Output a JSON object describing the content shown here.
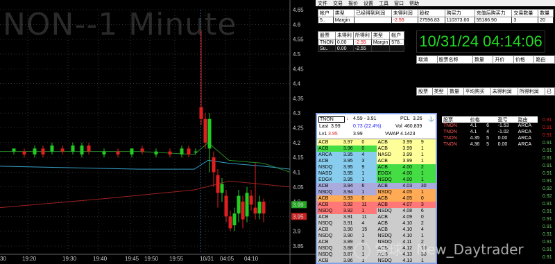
{
  "chart": {
    "watermark": "NON--1 Minute",
    "price_labels": [
      "4.65",
      "4.6",
      "4.55",
      "4.5",
      "4.45",
      "4.4",
      "4.35",
      "4.3",
      "4.25",
      "4.2",
      "4.15",
      "4.1",
      "4.05",
      "4.0",
      "3.95",
      "3.9",
      "3.85"
    ],
    "time_labels": [
      "19:20",
      "19:30",
      "19:40",
      "19:45",
      "19:50",
      "19:55",
      "10/31",
      "04:05",
      "04:10"
    ],
    "left_time": "30",
    "current_price_tag": "3.99",
    "low_price_tag": "3.95",
    "colors": {
      "up": "#22cc22",
      "down": "#e02020",
      "ema_green": "#2a8a2a",
      "ema_blue": "#36a0c8",
      "ema_red": "#a02020",
      "grid": "#555"
    }
  },
  "menu": [
    "文件",
    "交易",
    "报价",
    "设置",
    "工具",
    "窗口",
    "帮助"
  ],
  "account_table": {
    "headers": [
      "帐户",
      "类型",
      "已经得到利润",
      "未得利润",
      "股权",
      "购买力",
      "充值后购买力",
      "交易数量",
      "数量"
    ],
    "row": [
      "5..",
      "Margin",
      "",
      "-2.55",
      "27596.83",
      "110373.60",
      "55186.90",
      "3",
      "20"
    ]
  },
  "position_table": {
    "headers": [
      "股票",
      "未得利",
      "所得利",
      "类型",
      "帐户"
    ],
    "rows": [
      [
        "TNON",
        "0.00",
        "-2.55",
        "Margin",
        "578.."
      ],
      [
        "Su..",
        "0.00",
        "-2.55",
        "",
        ""
      ]
    ]
  },
  "clock": "10/31/24 04:14:06",
  "orders_headers": [
    "取消",
    "股票名称",
    "数量",
    "开价",
    "价格",
    "路由"
  ],
  "summary_headers": [
    "股票",
    "类型",
    "数量",
    "平均购买",
    "未得利润",
    "所得利润",
    "已"
  ],
  "level2": {
    "symbol": "TNON",
    "range": "4.59 - 3.91",
    "pcl_label": "PCL",
    "pcl_value": "3.26",
    "last_label": "Last",
    "last_value": "3.99",
    "change": "0.73",
    "change_pct": "(22.4%)",
    "vol_label": "Vol",
    "vol_value": "460,839",
    "lv1_label": "Lv1",
    "lv1_bid": "3.95",
    "lv1_ask": "3.99",
    "vwap_label": "VWAP",
    "vwap_value": "4.1423",
    "bids": [
      [
        "ACB",
        "3.97",
        "0"
      ],
      [
        "ACB",
        "3.96",
        "0"
      ],
      [
        "ARCA",
        "3.95",
        "4"
      ],
      [
        "ACB",
        "3.95",
        "3"
      ],
      [
        "NSDQ",
        "3.95",
        "9"
      ],
      [
        "NASD",
        "3.95",
        "1"
      ],
      [
        "EDGX",
        "3.95",
        "1"
      ],
      [
        "ACB",
        "3.94",
        "6"
      ],
      [
        "NSDQ",
        "3.94",
        "1"
      ],
      [
        "ACB",
        "3.93",
        "0"
      ],
      [
        "ACB",
        "3.92",
        "11"
      ],
      [
        "NSDQ",
        "3.92",
        "1"
      ],
      [
        "ACB",
        "3.91",
        "11"
      ],
      [
        "NSDQ",
        "3.91",
        "4"
      ],
      [
        "ACB",
        "3.90",
        "15"
      ],
      [
        "NSDQ",
        "3.90",
        "1"
      ],
      [
        "ACB",
        "3.89",
        "0"
      ],
      [
        "NSDQ",
        "3.88",
        "1"
      ],
      [
        "NSDQ",
        "3.87",
        "1"
      ],
      [
        "ACB",
        "3.86",
        "1"
      ],
      [
        "NSDQ",
        "3.85",
        "1"
      ]
    ],
    "bid_colors": [
      "#ffff99",
      "#44dd44",
      "#88ccee",
      "#88ccee",
      "#88ccee",
      "#88ccee",
      "#88ccee",
      "#aaaadd",
      "#aaaadd",
      "#ffaa55",
      "#ff7777",
      "#ff7777",
      "#cccccc",
      "#cccccc",
      "#cccccc",
      "#cccccc",
      "#cccccc",
      "#cccccc",
      "#cccccc",
      "#cccccc",
      "#cccccc"
    ],
    "asks": [
      [
        "ACB",
        "3.99",
        "9"
      ],
      [
        "ACB",
        "3.99",
        "1"
      ],
      [
        "NASD",
        "3.99",
        "1"
      ],
      [
        "ACB",
        "3.99",
        "1"
      ],
      [
        "ACB",
        "4.00",
        "2"
      ],
      [
        "EDGX",
        "4.00",
        "1"
      ],
      [
        "NSDQ",
        "4.00",
        "1"
      ],
      [
        "ACB",
        "4.03",
        "30"
      ],
      [
        "NSDQ",
        "4.05",
        "1"
      ],
      [
        "ACB",
        "4.05",
        "0"
      ],
      [
        "ACB",
        "4.07",
        "3"
      ],
      [
        "NSDQ",
        "4.08",
        "6"
      ],
      [
        "ACB",
        "4.09",
        "0"
      ],
      [
        "ACB",
        "4.10",
        "2"
      ],
      [
        "ACB",
        "4.10",
        "4"
      ],
      [
        "NSDQ",
        "4.10",
        "1"
      ],
      [
        "NSDQ",
        "4.11",
        "2"
      ],
      [
        "ACB",
        "4.12",
        "10"
      ],
      [
        "ACB",
        "4.13",
        "30"
      ],
      [
        "NSDQ",
        "4.13",
        "1"
      ],
      [
        "ACB",
        "4.15",
        "2"
      ]
    ],
    "ask_colors": [
      "#ffff99",
      "#ffff99",
      "#ffff99",
      "#ffff99",
      "#44dd44",
      "#44dd44",
      "#44dd44",
      "#aaaadd",
      "#ffaa55",
      "#ffaa55",
      "#ff7777",
      "#cccccc",
      "#cccccc",
      "#cccccc",
      "#cccccc",
      "#cccccc",
      "#cccccc",
      "#cccccc",
      "#cccccc",
      "#cccccc",
      "#cccccc"
    ]
  },
  "trades": {
    "headers": [
      "股票",
      "价格",
      "",
      "盈亏",
      "路由"
    ],
    "rows": [
      [
        "TNON",
        "4.1",
        "6",
        "-1.53",
        "ARCA"
      ],
      [
        "TNON",
        "4.1",
        "4",
        "-1.02",
        "ARCA"
      ],
      [
        "TNON",
        "4.35",
        "5",
        "0.00",
        "ARCA"
      ],
      [
        "TNON",
        "4.36",
        "5",
        "0.00",
        "ARCA"
      ]
    ]
  },
  "right_strip": [
    "0.91",
    "0.91",
    "0.91",
    "0.91",
    "0.91",
    "0.91",
    "0.91",
    "0.91",
    "0.91",
    "0.92",
    "0.92",
    "0.91",
    "0.91",
    "0.91",
    "0.91",
    "0.91",
    "0.91",
    "0.91",
    "0.91"
  ],
  "brand_watermark": "雪球：New_Daytrader"
}
